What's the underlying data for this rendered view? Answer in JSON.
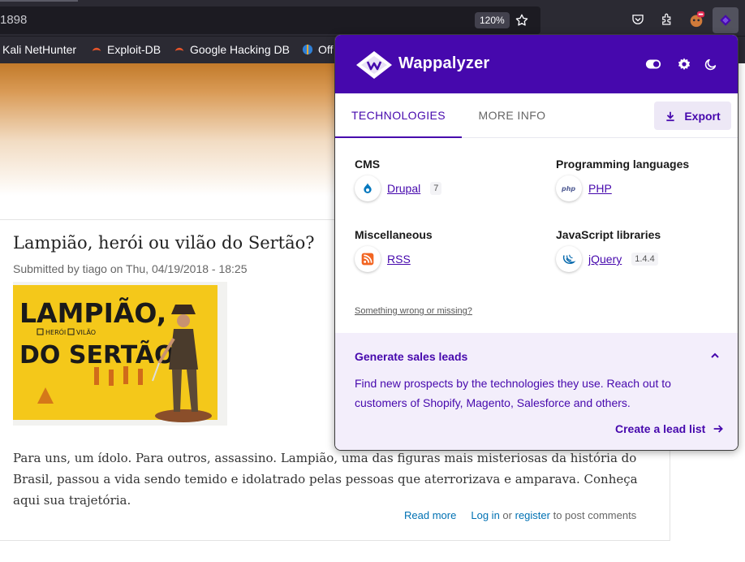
{
  "browser": {
    "url_fragment": "1898",
    "zoom": "120%",
    "bookmarks": [
      {
        "label": "Kali NetHunter"
      },
      {
        "label": "Exploit-DB"
      },
      {
        "label": "Google Hacking DB"
      },
      {
        "label": "Off"
      }
    ]
  },
  "article": {
    "title": "Lampião, herói ou vilão do Sertão?",
    "submitted": "Submitted by tiago on Thu, 04/19/2018 - 18:25",
    "image_text": {
      "line1": "LAMPIÃO,",
      "heroi": "HERÓI",
      "vilao": "VILÃO",
      "line2": "DO SERTÃO"
    },
    "body": "Para uns, um ídolo. Para outros, assassino. Lampião, uma das figuras mais misteriosas da história do Brasil, passou a vida sendo temido e idolatrado pelas pessoas que aterrorizava e amparava. Conheça aqui sua trajetória.",
    "read_more": "Read more",
    "login": "Log in",
    "or": "or",
    "register": "register",
    "post_comments": "to post comments"
  },
  "wappalyzer": {
    "title": "Wappalyzer",
    "tabs": {
      "technologies": "TECHNOLOGIES",
      "more_info": "MORE INFO"
    },
    "export_label": "Export",
    "categories": [
      {
        "name": "CMS",
        "tech": "Drupal",
        "version": "7",
        "icon": "drupal-icon"
      },
      {
        "name": "Programming languages",
        "tech": "PHP",
        "version": "",
        "icon": "php-icon"
      },
      {
        "name": "Miscellaneous",
        "tech": "RSS",
        "version": "",
        "icon": "rss-icon"
      },
      {
        "name": "JavaScript libraries",
        "tech": "jQuery",
        "version": "1.4.4",
        "icon": "jquery-icon"
      }
    ],
    "wrong_link": "Something wrong or missing?",
    "leads": {
      "title": "Generate sales leads",
      "text": "Find new prospects by the technologies they use. Reach out to customers of Shopify, Magento, Salesforce and others.",
      "link": "Create a lead list"
    },
    "colors": {
      "brand": "#4608ad",
      "leads_bg": "#f3eefb"
    }
  }
}
